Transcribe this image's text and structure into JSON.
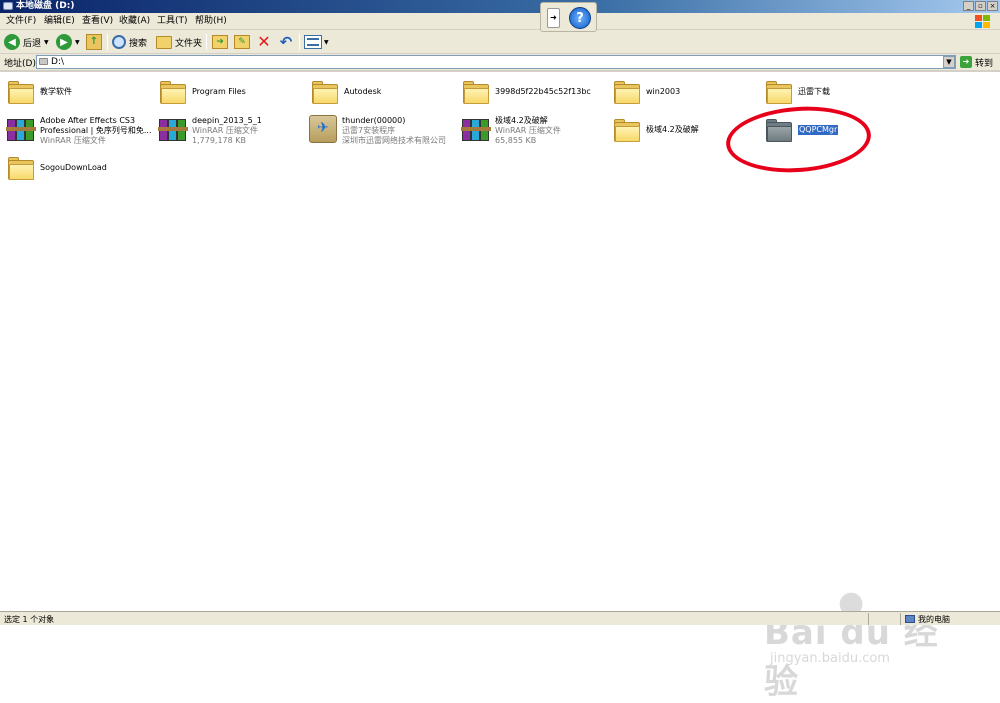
{
  "window": {
    "title": "本地磁盘 (D:)",
    "caption_min": "_",
    "caption_max": "▫",
    "caption_close": "×"
  },
  "menubar": {
    "items": [
      "文件(F)",
      "编辑(E)",
      "查看(V)",
      "收藏(A)",
      "工具(T)",
      "帮助(H)"
    ]
  },
  "toolbar": {
    "back_label": "后退",
    "search_label": "搜索",
    "folders_label": "文件夹"
  },
  "addressbar": {
    "label": "地址(D)",
    "value": "D:\\",
    "go_label": "转到"
  },
  "items": [
    {
      "type": "folder",
      "name": "教学软件"
    },
    {
      "type": "folder",
      "name": "Program Files"
    },
    {
      "type": "folder",
      "name": "Autodesk"
    },
    {
      "type": "folder",
      "name": "3998d5f22b45c52f13bc"
    },
    {
      "type": "folder",
      "name": "win2003"
    },
    {
      "type": "folder",
      "name": "迅雷下载"
    },
    {
      "type": "rar",
      "name": "Adobe After Effects CS3",
      "name2": "Professional | 免序列号和免...",
      "sub": "WinRAR 压缩文件"
    },
    {
      "type": "rar",
      "name": "deepin_2013_5_1",
      "sub": "WinRAR 压缩文件",
      "sub2": "1,779,178 KB"
    },
    {
      "type": "exe",
      "name": "thunder(00000)",
      "sub": "迅雷7安装程序",
      "sub2": "深圳市迅雷网络技术有限公司"
    },
    {
      "type": "rar",
      "name": "极域4.2及破解",
      "sub": "WinRAR 压缩文件",
      "sub2": "65,855 KB"
    },
    {
      "type": "folder",
      "name": "极域4.2及破解"
    },
    {
      "type": "folder",
      "name": "QQPCMgr",
      "selected": true
    },
    {
      "type": "folder",
      "name": "SogouDownLoad"
    }
  ],
  "statusbar": {
    "left": "选定 1 个对象",
    "right": "我的电脑"
  },
  "watermark": {
    "brand": "Bai du 经验",
    "url": "jingyan.baidu.com"
  },
  "colors": {
    "selection": "#316ac5",
    "annotation": "#e8001a",
    "folder": "#e8c55d"
  }
}
